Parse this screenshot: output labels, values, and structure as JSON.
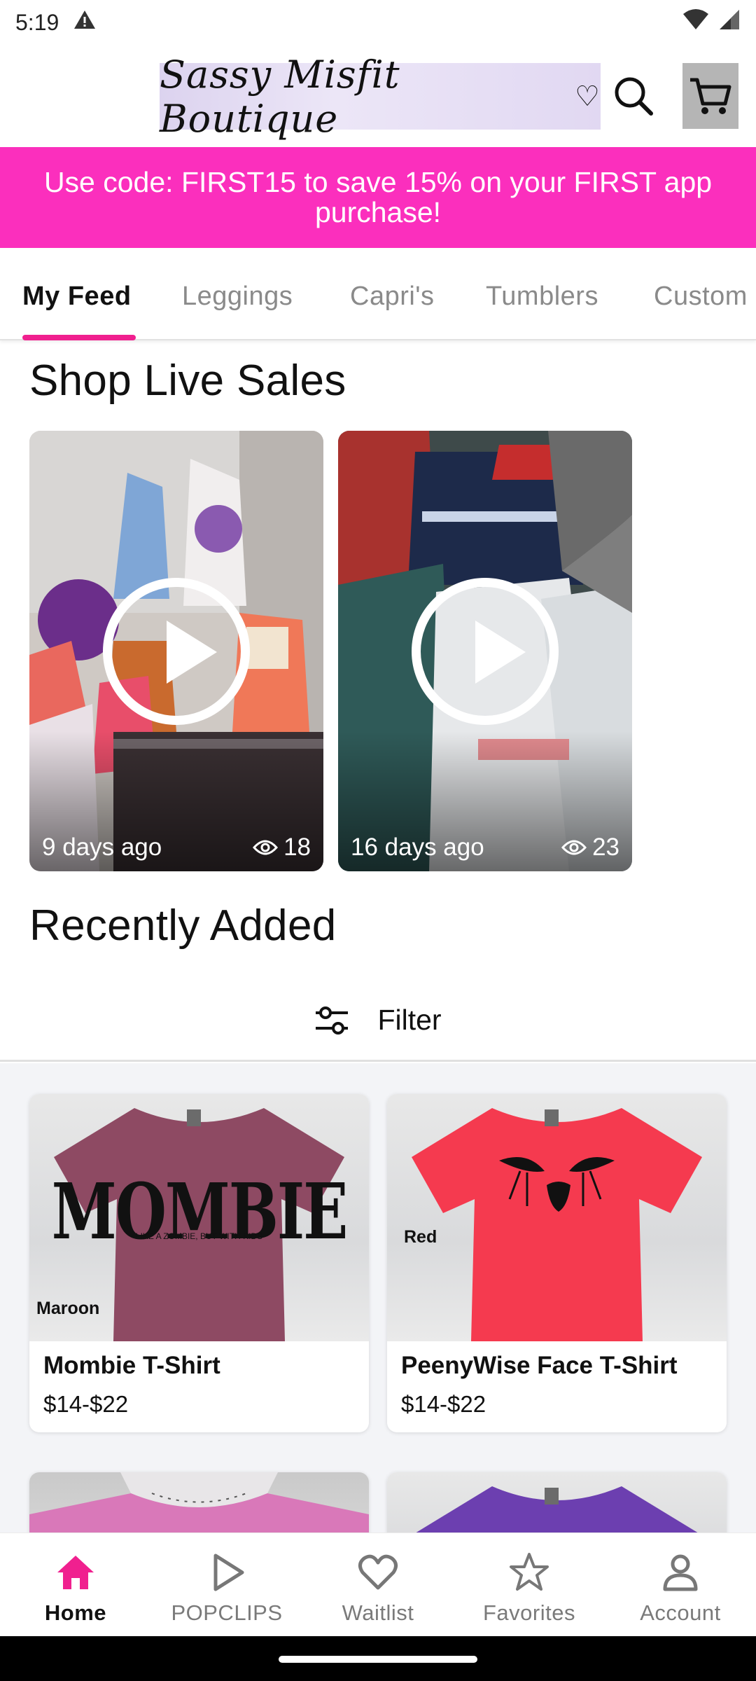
{
  "status_bar": {
    "time": "5:19"
  },
  "header": {
    "logo_text": "Sassy Misfit Boutique"
  },
  "promo": {
    "text": "Use code: FIRST15 to save 15% on your FIRST app purchase!"
  },
  "tabs": [
    {
      "label": "My Feed",
      "active": true
    },
    {
      "label": "Leggings",
      "active": false
    },
    {
      "label": "Capri's",
      "active": false
    },
    {
      "label": "Tumblers",
      "active": false
    },
    {
      "label": "Custom",
      "active": false
    }
  ],
  "live_sales": {
    "title": "Shop Live Sales",
    "videos": [
      {
        "age": "9 days ago",
        "views": "18"
      },
      {
        "age": "16 days ago",
        "views": "23"
      }
    ]
  },
  "recently_added": {
    "title": "Recently Added",
    "filter_label": "Filter",
    "products": [
      {
        "name": "Mombie T-Shirt",
        "price": "$14-$22",
        "color_tag": "Maroon",
        "shirt_color": "#8e4a63",
        "shirt_print": "MOMBIE",
        "shirt_subprint": "LIKE A ZOMBIE, BUT WITH KIDS"
      },
      {
        "name": "PeenyWise Face T-Shirt",
        "price": "$14-$22",
        "color_tag": "Red",
        "shirt_color": "#f53a4f"
      },
      {
        "shirt_color": "#d978b9"
      },
      {
        "shirt_color": "#6c3fb0"
      }
    ]
  },
  "bottom_nav": [
    {
      "label": "Home",
      "icon": "home-icon",
      "active": true
    },
    {
      "label": "POPCLIPS",
      "icon": "play-icon",
      "active": false
    },
    {
      "label": "Waitlist",
      "icon": "heart-icon",
      "active": false
    },
    {
      "label": "Favorites",
      "icon": "star-icon",
      "active": false
    },
    {
      "label": "Account",
      "icon": "person-icon",
      "active": false
    }
  ],
  "colors": {
    "accent_pink": "#f0208f",
    "promo_bg": "#fb2fbd"
  }
}
